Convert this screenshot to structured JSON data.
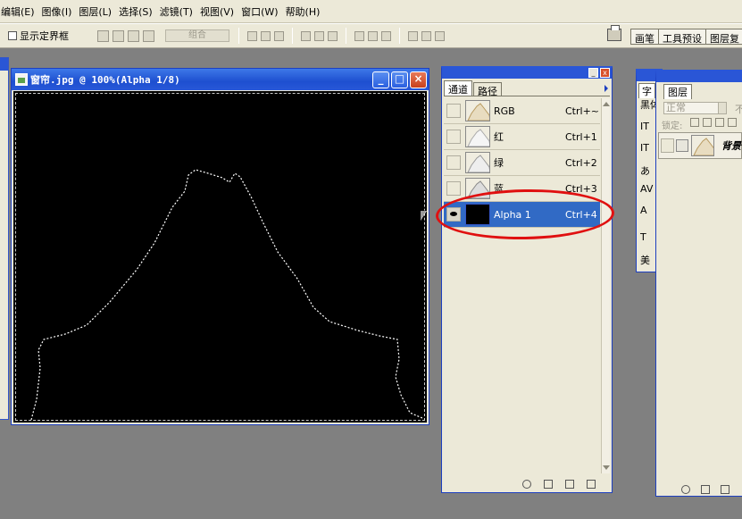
{
  "menu": [
    "编辑(E)",
    "图像(I)",
    "图层(L)",
    "选择(S)",
    "滤镜(T)",
    "视图(V)",
    "窗口(W)",
    "帮助(H)"
  ],
  "options": {
    "show_bounding_box": "显示定界框",
    "combine": "组合"
  },
  "dock_tabs": [
    "画笔",
    "工具预设",
    "图层复"
  ],
  "document": {
    "title": "窗帘.jpg @ 100%(Alpha 1/8)"
  },
  "channels_panel": {
    "tabs": [
      "通道",
      "路径"
    ],
    "channels": [
      {
        "name": "RGB",
        "shortcut": "Ctrl+~",
        "visible": false,
        "selected": false
      },
      {
        "name": "红",
        "shortcut": "Ctrl+1",
        "visible": false,
        "selected": false
      },
      {
        "name": "绿",
        "shortcut": "Ctrl+2",
        "visible": false,
        "selected": false
      },
      {
        "name": "蓝",
        "shortcut": "Ctrl+3",
        "visible": false,
        "selected": false
      },
      {
        "name": "Alpha 1",
        "shortcut": "Ctrl+4",
        "visible": true,
        "selected": true
      }
    ]
  },
  "character_panel": {
    "tab": "字",
    "lines": [
      "黑体",
      "IT",
      "IT",
      "あ",
      "AV",
      "A",
      "T",
      "美"
    ]
  },
  "layers_panel": {
    "tab": "图层",
    "blend_mode": "正常",
    "opacity_label": "不",
    "lock_label": "锁定:",
    "layer_name": "背景"
  },
  "colors": {
    "title_bar": "#1e4fd0",
    "selection": "#316ac5",
    "annotation": "#e01010",
    "canvas": "#000000"
  }
}
